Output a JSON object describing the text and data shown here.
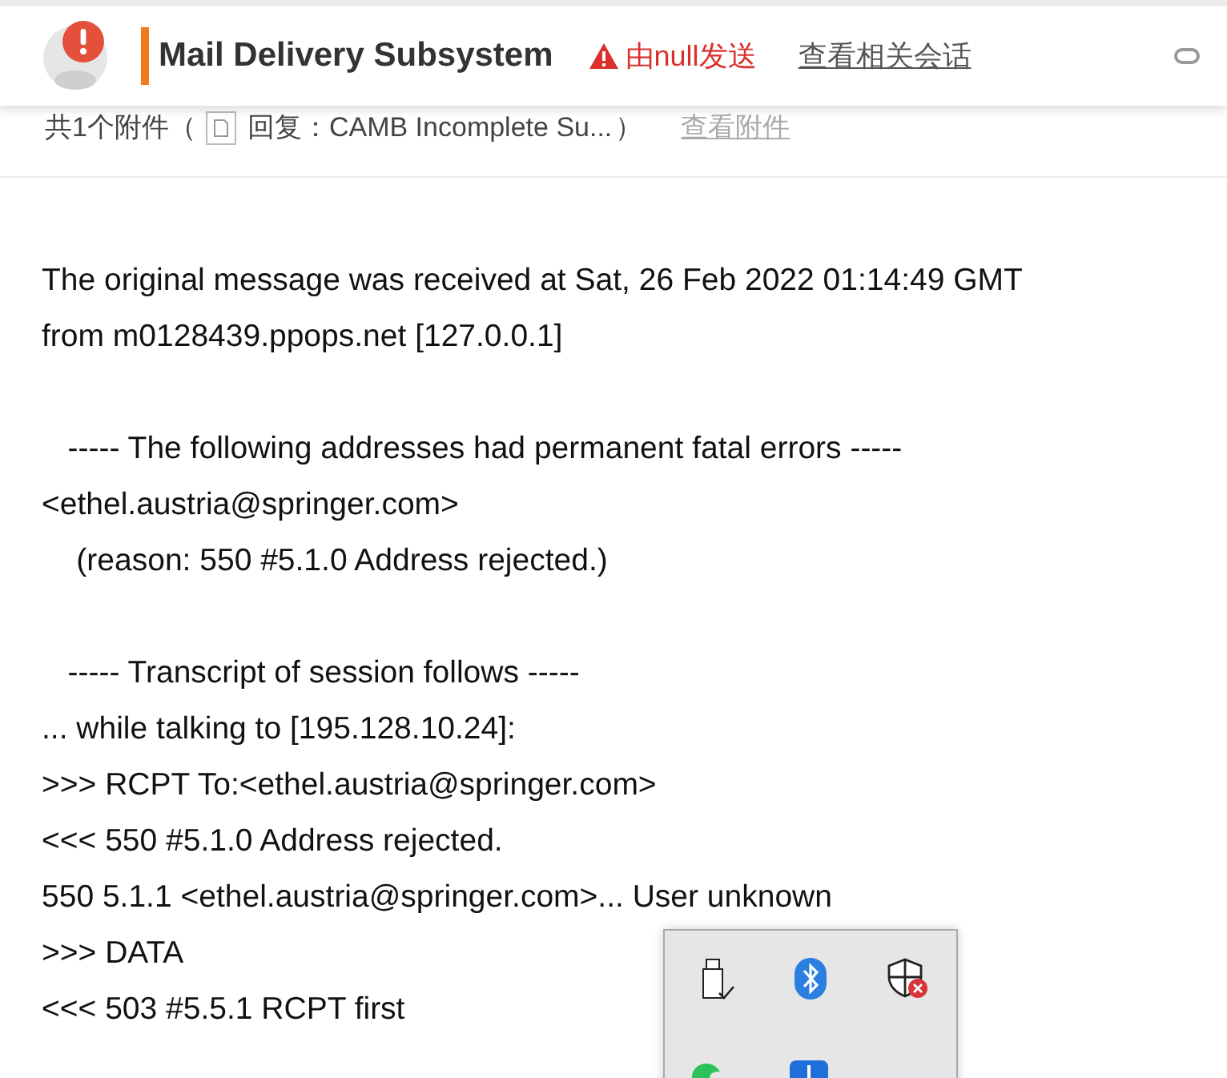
{
  "header": {
    "sender": "Mail Delivery Subsystem",
    "warning": "由null发送",
    "related_link": "查看相关会话"
  },
  "attachments": {
    "count_label": "共1个附件（",
    "file_name": "回复：CAMB Incomplete Su...",
    "close_paren": "）",
    "view_link": "查看附件"
  },
  "body": [
    [
      "The original message was received at Sat, 26 Feb 2022 01:14:49 GMT",
      "from m0128439.ppops.net [127.0.0.1]"
    ],
    [
      "   ----- The following addresses had permanent fatal errors -----",
      "<ethel.austria@springer.com>",
      "    (reason: 550 #5.1.0 Address rejected.)"
    ],
    [
      "   ----- Transcript of session follows -----",
      "... while talking to [195.128.10.24]:",
      ">>> RCPT To:<ethel.austria@springer.com>",
      "<<< 550 #5.1.0 Address rejected.",
      "550 5.1.1 <ethel.austria@springer.com>... User unknown",
      ">>> DATA",
      "<<< 503 #5.5.1 RCPT first"
    ]
  ]
}
